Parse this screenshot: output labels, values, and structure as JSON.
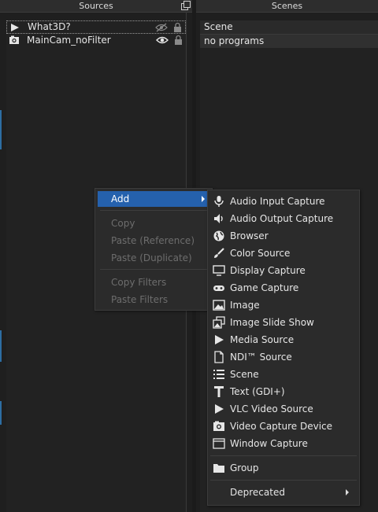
{
  "sources": {
    "header": "Sources",
    "items": [
      {
        "label": "What3D?",
        "icon": "media-play-icon",
        "visible": false
      },
      {
        "label": "MainCam_noFilter",
        "icon": "camera-icon",
        "visible": true
      }
    ]
  },
  "scenes": {
    "header": "Scenes",
    "column_header": "Scene",
    "items": [
      "no programs"
    ]
  },
  "context_menu": {
    "add": "Add",
    "copy": "Copy",
    "paste_reference": "Paste (Reference)",
    "paste_duplicate": "Paste (Duplicate)",
    "copy_filters": "Copy Filters",
    "paste_filters": "Paste Filters"
  },
  "add_menu": {
    "items": [
      {
        "label": "Audio Input Capture",
        "icon": "microphone-icon"
      },
      {
        "label": "Audio Output Capture",
        "icon": "speaker-icon"
      },
      {
        "label": "Browser",
        "icon": "globe-icon"
      },
      {
        "label": "Color Source",
        "icon": "paintbrush-icon"
      },
      {
        "label": "Display Capture",
        "icon": "monitor-icon"
      },
      {
        "label": "Game Capture",
        "icon": "gamepad-icon"
      },
      {
        "label": "Image",
        "icon": "image-icon"
      },
      {
        "label": "Image Slide Show",
        "icon": "slideshow-icon"
      },
      {
        "label": "Media Source",
        "icon": "play-icon"
      },
      {
        "label": "NDI™ Source",
        "icon": "file-icon"
      },
      {
        "label": "Scene",
        "icon": "list-icon"
      },
      {
        "label": "Text (GDI+)",
        "icon": "text-icon"
      },
      {
        "label": "VLC Video Source",
        "icon": "play-icon"
      },
      {
        "label": "Video Capture Device",
        "icon": "camera-icon"
      },
      {
        "label": "Window Capture",
        "icon": "window-icon"
      }
    ],
    "group": {
      "label": "Group",
      "icon": "folder-icon"
    },
    "deprecated": "Deprecated"
  },
  "colors": {
    "accent": "#2561ad",
    "menu_bg": "#2b2b2b",
    "disabled_text": "#6d6d6d"
  }
}
